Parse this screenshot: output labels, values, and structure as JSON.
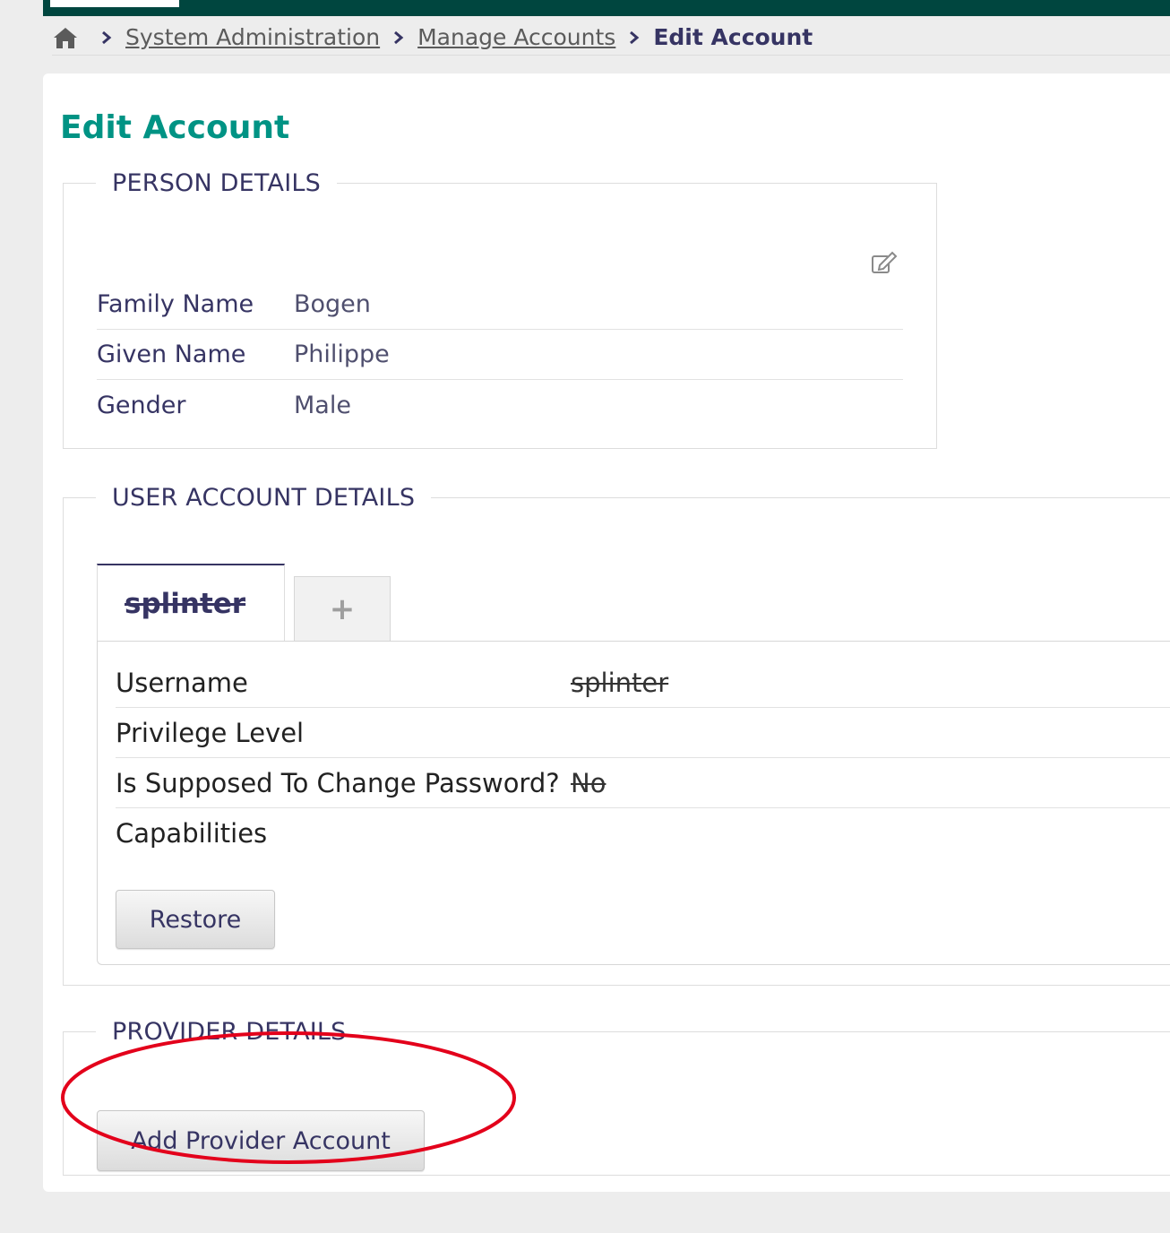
{
  "breadcrumb": {
    "home_icon": "home-icon",
    "items": [
      "System Administration",
      "Manage Accounts"
    ],
    "current": "Edit Account"
  },
  "page": {
    "title": "Edit Account"
  },
  "person_details": {
    "legend": "PERSON DETAILS",
    "edit_icon": "edit-icon",
    "rows": [
      {
        "label": "Family Name",
        "value": "Bogen"
      },
      {
        "label": "Given Name",
        "value": "Philippe"
      },
      {
        "label": "Gender",
        "value": "Male"
      }
    ]
  },
  "user_account_details": {
    "legend": "USER ACCOUNT DETAILS",
    "active_tab": "splinter",
    "add_tab": "+",
    "rows": [
      {
        "label": "Username",
        "value": "splinter"
      },
      {
        "label": "Privilege Level",
        "value": ""
      },
      {
        "label": "Is Supposed To Change Password?",
        "value": "No"
      },
      {
        "label": "Capabilities",
        "value": ""
      }
    ],
    "restore_button": "Restore"
  },
  "provider_details": {
    "legend": "PROVIDER DETAILS",
    "add_button": "Add Provider Account"
  },
  "colors": {
    "topbar": "#00463f",
    "title": "#009384",
    "text": "#363463",
    "annotation": "#e3001b"
  }
}
